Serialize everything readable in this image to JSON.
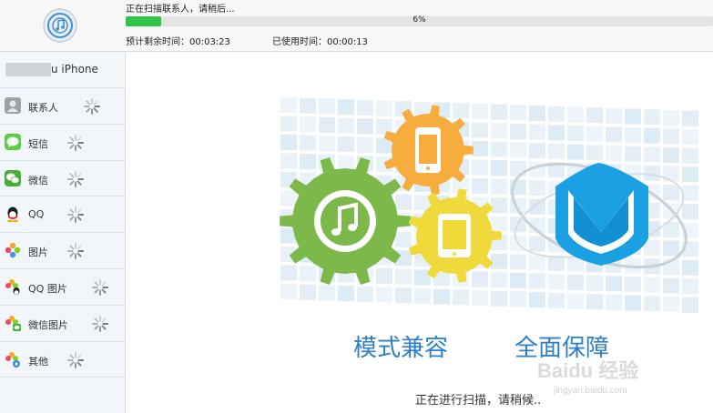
{
  "header": {
    "status": "正在扫描联系人，请稍后...",
    "progress_percent": 6,
    "progress_label": "6%",
    "time_remaining": "预计剩余时间：00:03:23",
    "time_used": "已使用时间：00:00:13",
    "logo_icon": "music-disc-icon"
  },
  "sidebar": {
    "device_name": "u iPhone",
    "items": [
      {
        "label": "联系人",
        "icon": "contacts-icon"
      },
      {
        "label": "短信",
        "icon": "sms-icon"
      },
      {
        "label": "微信",
        "icon": "wechat-icon"
      },
      {
        "label": "QQ",
        "icon": "qq-icon"
      },
      {
        "label": "图片",
        "icon": "photos-icon"
      },
      {
        "label": "QQ 图片",
        "icon": "qq-photos-icon"
      },
      {
        "label": "微信图片",
        "icon": "wechat-photos-icon"
      },
      {
        "label": "其他",
        "icon": "other-icon"
      }
    ]
  },
  "main": {
    "slogan_left": "模式兼容",
    "slogan_right": "全面保障",
    "scan_message": "正在进行扫描，请稍候..",
    "watermark": "Baidu 经验",
    "watermark_url": "jingyan.baidu.com"
  },
  "colors": {
    "progress": "#32c24a",
    "slogan": "#2d7fc6",
    "gear_green": "#7cb84a",
    "gear_orange": "#f7ad3e",
    "gear_yellow": "#f0d93a",
    "shield": "#1ba0e4"
  }
}
